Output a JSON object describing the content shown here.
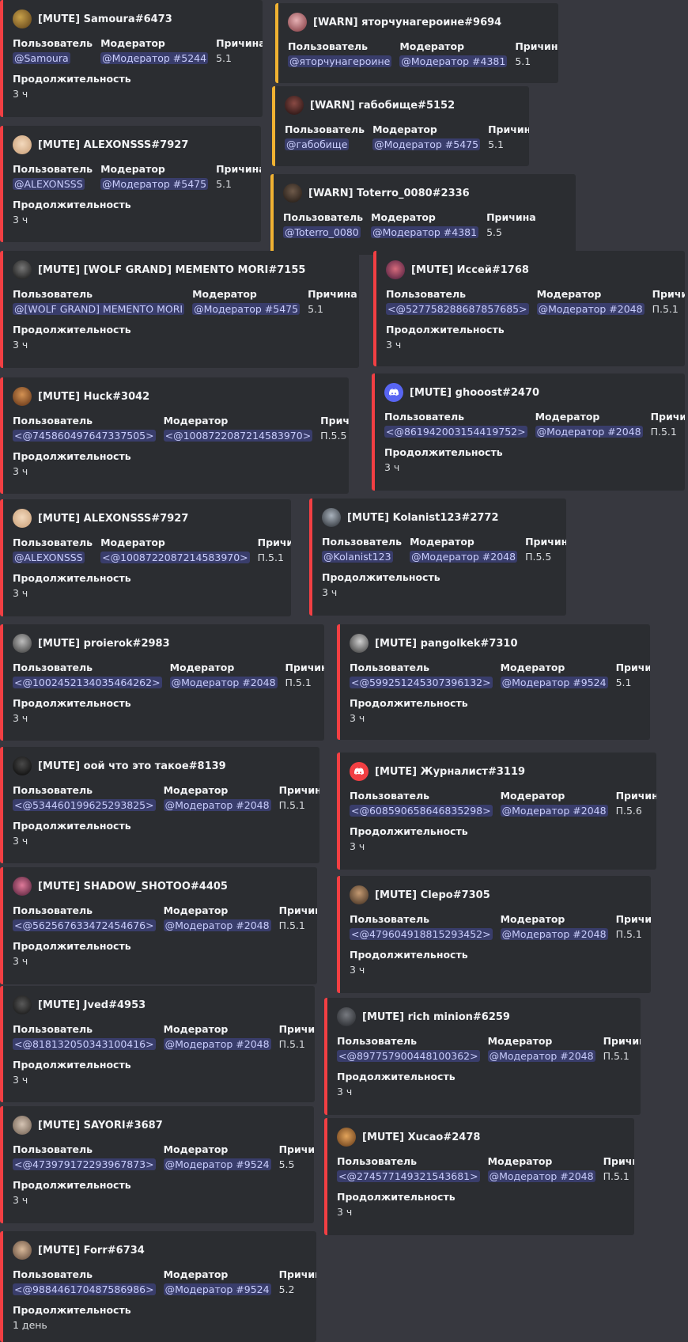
{
  "labels": {
    "user": "Пользователь",
    "moderator": "Модератор",
    "reason": "Причина",
    "duration": "Продолжительность"
  },
  "colors": {
    "mute": "#f23f43",
    "warn": "#f0b232",
    "mention_bg": "#3c4270",
    "mention_text": "#c9cdfb",
    "discord_blurple": "#5865f2",
    "discord_red": "#f23f43"
  },
  "embeds": [
    {
      "type": "mute",
      "title": "[MUTE] Samoura#6473",
      "user": "@Samoura",
      "moderator": "@Модератор #5244",
      "reason": "5.1",
      "duration": "3 ч",
      "avatar": "photo"
    },
    {
      "type": "warn",
      "title": "[WARN] яторчунагероине#9694",
      "user": "@яторчунагероине",
      "moderator": "@Модератор #4381",
      "reason": "5.1",
      "avatar": "photo"
    },
    {
      "type": "warn",
      "title": "[WARN] габобище#5152",
      "user": "@габобище",
      "moderator": "@Модератор #5475",
      "reason": "5.1",
      "avatar": "photo"
    },
    {
      "type": "mute",
      "title": "[MUTE] ALEXONSSS#7927",
      "user": "@ALEXONSSS",
      "moderator": "@Модератор #5475",
      "reason": "5.1",
      "duration": "3 ч",
      "avatar": "photo"
    },
    {
      "type": "warn",
      "title": "[WARN] Toterro_0080#2336",
      "user": "@Toterro_0080",
      "moderator": "@Модератор #4381",
      "reason": "5.5",
      "avatar": "photo"
    },
    {
      "type": "mute",
      "title": "[MUTE] [WOLF GRAND] MEMENTO MORI#7155",
      "user": "@[WOLF GRAND] MEMENTO MORI",
      "moderator": "@Модератор #5475",
      "reason": "5.1",
      "duration": "3 ч",
      "avatar": "photo"
    },
    {
      "type": "mute",
      "title": "[MUTE] Иссей#1768",
      "user": "<@527758288687857685>",
      "moderator": "@Модератор #2048",
      "reason": "П.5.1",
      "duration": "3 ч",
      "avatar": "photo"
    },
    {
      "type": "mute",
      "title": "[MUTE] Huck#3042",
      "user": "<@745860497647337505>",
      "moderator": "<@1008722087214583970>",
      "reason": "П.5.5",
      "duration": "3 ч",
      "avatar": "photo"
    },
    {
      "type": "mute",
      "title": "[MUTE] ghooost#2470",
      "user": "<@861942003154419752>",
      "moderator": "@Модератор #2048",
      "reason": "П.5.1",
      "duration": "3 ч",
      "avatar": "discord-blue"
    },
    {
      "type": "mute",
      "title": "[MUTE] ALEXONSSS#7927",
      "user": "@ALEXONSSS",
      "moderator": "<@1008722087214583970>",
      "reason": "П.5.1",
      "duration": "3 ч",
      "avatar": "photo"
    },
    {
      "type": "mute",
      "title": "[MUTE] Kolanist123#2772",
      "user": "@Kolanist123",
      "moderator": "@Модератор #2048",
      "reason": "П.5.5",
      "duration": "3 ч",
      "avatar": "photo"
    },
    {
      "type": "mute",
      "title": "[MUTE] proierok#2983",
      "user": "<@1002452134035464262>",
      "moderator": "@Модератор #2048",
      "reason": "П.5.1",
      "duration": "3 ч",
      "avatar": "photo"
    },
    {
      "type": "mute",
      "title": "[MUTE] pangolkek#7310",
      "user": "<@599251245307396132>",
      "moderator": "@Модератор #9524",
      "reason": "5.1",
      "duration": "3 ч",
      "avatar": "photo"
    },
    {
      "type": "mute",
      "title": "[MUTE] оой что это такое#8139",
      "user": "<@534460199625293825>",
      "moderator": "@Модератор #2048",
      "reason": "П.5.1",
      "duration": "3 ч",
      "avatar": "photo"
    },
    {
      "type": "mute",
      "title": "[MUTE] Журналист#3119",
      "user": "<@608590658646835298>",
      "moderator": "@Модератор #2048",
      "reason": "П.5.6",
      "duration": "3 ч",
      "avatar": "discord-red"
    },
    {
      "type": "mute",
      "title": "[MUTE] SHADOW_SHOTOO#4405",
      "user": "<@562567633472454676>",
      "moderator": "@Модератор #2048",
      "reason": "П.5.1",
      "duration": "3 ч",
      "avatar": "photo"
    },
    {
      "type": "mute",
      "title": "[MUTE] Clepo#7305",
      "user": "<@479604918815293452>",
      "moderator": "@Модератор #2048",
      "reason": "П.5.1",
      "duration": "3 ч",
      "avatar": "photo"
    },
    {
      "type": "mute",
      "title": "[MUTE] Jved#4953",
      "user": "<@818132050343100416>",
      "moderator": "@Модератор #2048",
      "reason": "П.5.1",
      "duration": "3 ч",
      "avatar": "photo"
    },
    {
      "type": "mute",
      "title": "[MUTE] rich minion#6259",
      "user": "<@897757900448100362>",
      "moderator": "@Модератор #2048",
      "reason": "П.5.1",
      "duration": "3 ч",
      "avatar": "photo"
    },
    {
      "type": "mute",
      "title": "[MUTE] SAYORI#3687",
      "user": "<@473979172293967873>",
      "moderator": "@Модератор #9524",
      "reason": "5.5",
      "duration": "3 ч",
      "avatar": "photo"
    },
    {
      "type": "mute",
      "title": "[MUTE] Xucao#2478",
      "user": "<@274577149321543681>",
      "moderator": "@Модератор #2048",
      "reason": "П.5.1",
      "duration": "3 ч",
      "avatar": "photo"
    },
    {
      "type": "mute",
      "title": "[MUTE] Forr#6734",
      "user": "<@988446170487586986>",
      "moderator": "@Модератор #9524",
      "reason": "5.2",
      "duration": "1 день",
      "avatar": "photo"
    }
  ]
}
